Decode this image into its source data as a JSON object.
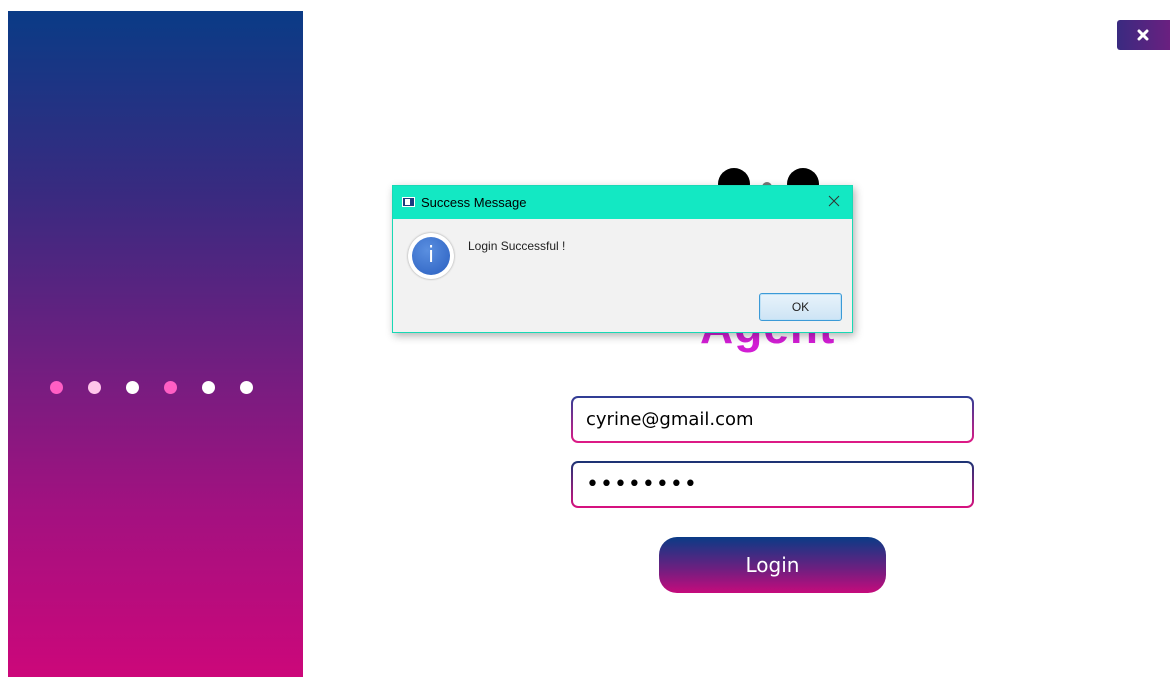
{
  "window": {
    "close_icon": "close-x-icon"
  },
  "side_panel": {
    "dots": [
      "pink",
      "lightpink",
      "white",
      "pink",
      "white",
      "white"
    ],
    "gradient_top": "#0a3b86",
    "gradient_bottom": "#cc077a"
  },
  "brand": {
    "title": "Agent",
    "color": "#d21ed4"
  },
  "form": {
    "email_value": "cyrine@gmail.com",
    "password_value": "••••••••",
    "login_label": "Login"
  },
  "dialog": {
    "title": "Success Message",
    "message": "Login Successful !",
    "ok_label": "OK",
    "icon": "info-icon",
    "titlebar_color": "#13e8c3"
  }
}
